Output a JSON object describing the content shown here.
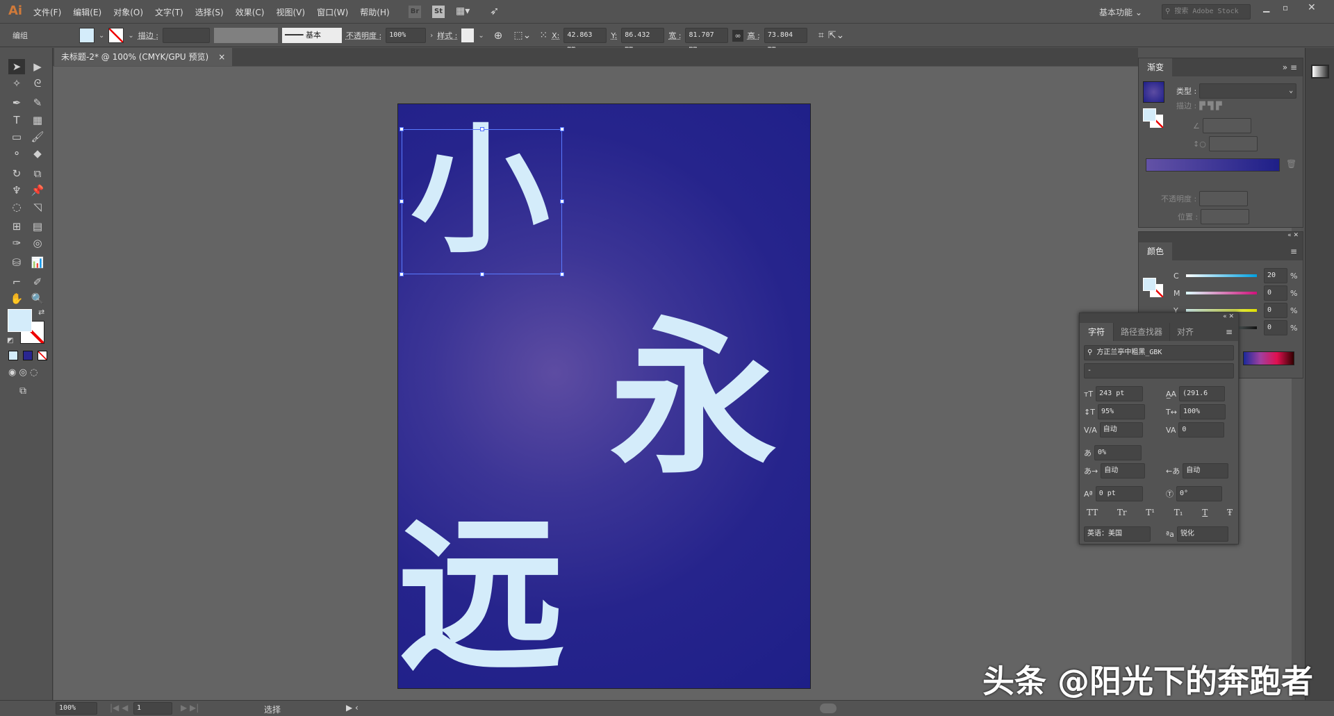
{
  "app": {
    "logo": "Ai",
    "menu": [
      "文件(F)",
      "编辑(E)",
      "对象(O)",
      "文字(T)",
      "选择(S)",
      "效果(C)",
      "视图(V)",
      "窗口(W)",
      "帮助(H)"
    ],
    "bridge": "Br",
    "stock": "St",
    "workspace": "基本功能",
    "search_placeholder": "搜索 Adobe Stock"
  },
  "control": {
    "selection_label": "编组",
    "stroke_label": "描边 :",
    "stroke_profile": "基本",
    "opacity_label": "不透明度 :",
    "opacity": "100%",
    "style_label": "样式 :",
    "x_label": "X:",
    "x": "42.863 mm",
    "y_label": "Y:",
    "y": "86.432 mm",
    "w_label": "宽 :",
    "w": "81.707 mm",
    "h_label": "高 :",
    "h": "73.804 mm"
  },
  "document": {
    "tab_title": "未标题-2* @ 100% (CMYK/GPU 预览)",
    "close": "×"
  },
  "artboard": {
    "chars": [
      "小",
      "永",
      "远"
    ],
    "colors": {
      "text": "#d4ecfa",
      "gradient_center": "#5d4ca2",
      "gradient_edge": "#1e1f88"
    }
  },
  "gradient_panel": {
    "title": "渐变",
    "type_label": "类型 :",
    "stroke_label": "描边 :",
    "opacity_label": "不透明度 :",
    "position_label": "位置 :"
  },
  "color_panel": {
    "title": "颜色",
    "channels": [
      {
        "name": "C",
        "value": "20"
      },
      {
        "name": "M",
        "value": "0"
      },
      {
        "name": "Y",
        "value": "0"
      },
      {
        "name": "K",
        "value": "0"
      }
    ],
    "unit": "%"
  },
  "character_panel": {
    "tabs": [
      "字符",
      "路径查找器",
      "对齐"
    ],
    "font": "方正兰亭中粗黑_GBK",
    "style": "-",
    "size": "243 pt",
    "leading": "(291.6",
    "vscale": "95%",
    "hscale": "100%",
    "kerning": "自动",
    "tracking": "0",
    "tsume": "0%",
    "aki_left": "自动",
    "aki_right": "自动",
    "baseline": "0 pt",
    "rotation": "0°",
    "language": "英语：美国",
    "antialias": "锐化",
    "type_buttons": [
      "TT",
      "Tr",
      "T¹",
      "T₁",
      "T",
      "Ŧ"
    ]
  },
  "status": {
    "zoom": "100%",
    "page": "1",
    "tool": "选择"
  },
  "watermark": "头条 @阳光下的奔跑者"
}
